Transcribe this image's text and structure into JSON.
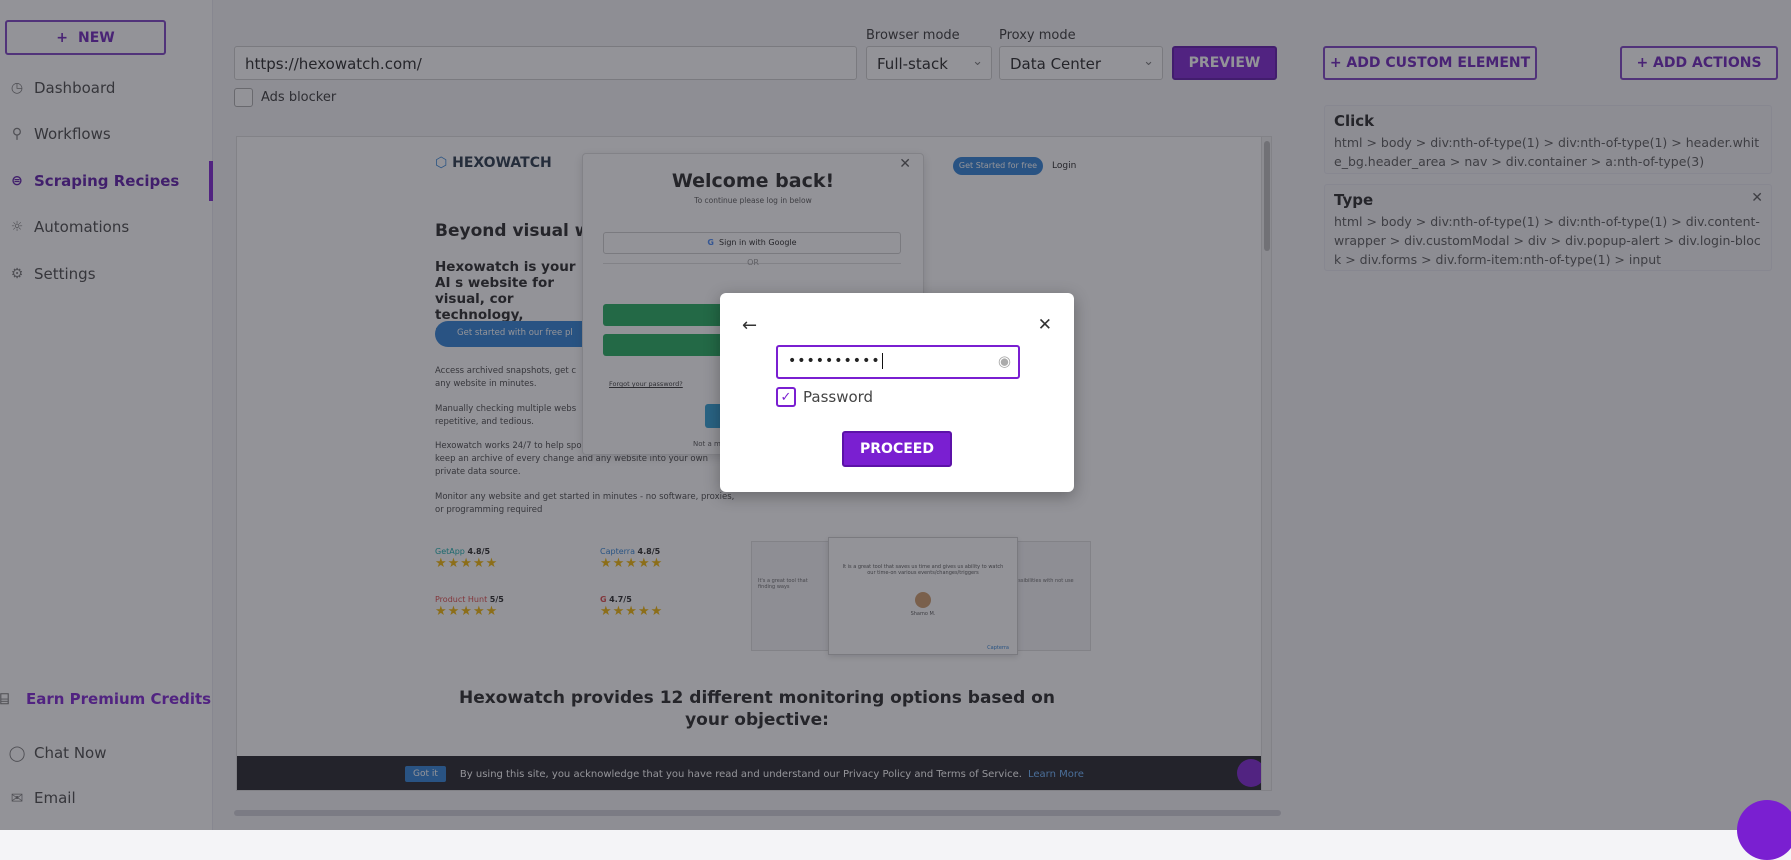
{
  "sidebar": {
    "new_label": "NEW",
    "items": [
      {
        "label": "Dashboard",
        "icon": "clock-icon"
      },
      {
        "label": "Workflows",
        "icon": "workflow-icon"
      },
      {
        "label": "Scraping Recipes",
        "icon": "recipe-icon"
      },
      {
        "label": "Automations",
        "icon": "bulb-icon"
      },
      {
        "label": "Settings",
        "icon": "gear-icon"
      }
    ],
    "earn_label": "Earn Premium Credits",
    "chat_label": "Chat Now",
    "email_label": "Email"
  },
  "toolbar": {
    "url_value": "https://hexowatch.com/",
    "browser_mode_label": "Browser mode",
    "browser_mode_value": "Full-stack",
    "proxy_mode_label": "Proxy mode",
    "proxy_mode_value": "Data Center",
    "preview_label": "PREVIEW",
    "ads_blocker_label": "Ads blocker",
    "add_custom_label": "+ ADD CUSTOM ELEMENT",
    "add_actions_label": "+ ADD ACTIONS"
  },
  "steps": [
    {
      "type": "Click",
      "selector": "html > body > div:nth-of-type(1) > div:nth-of-type(1) > header.white_bg.header_area > nav > div.container > a:nth-of-type(3)"
    },
    {
      "type": "Type",
      "selector": "html > body > div:nth-of-type(1) > div:nth-of-type(1) > div.content-wrapper > div.customModal > div > div.popup-alert > div.login-block > div.forms > div.form-item:nth-of-type(1) > input"
    }
  ],
  "preview_page": {
    "logo": "HEXOWATCH",
    "get_started": "Get Started for free",
    "login": "Login",
    "headline": "Beyond visual we",
    "subhead": "Hexowatch is your AI s website for visual, cor technology, availabili",
    "cta": "Get started with our free pl",
    "para1": "Access archived snapshots, get c any website in minutes.",
    "para2": "Manually checking multiple webs repetitive, and tedious.",
    "para3": "Hexowatch works 24/7 to help spo visually check your website, keep an archive of every change and any website into your own private data source.",
    "para4": "Monitor any website and get started in minutes - no software, proxies, or programming required",
    "rating1_name": "GetApp",
    "rating1": "4.8/5",
    "rating2_name": "Capterra",
    "rating2": "4.8/5",
    "rating3_name": "Product Hunt",
    "rating3": "5/5",
    "rating4": "4.7/5",
    "testimonial_text": "It is a great tool that saves us time and gives us ability to watch our time-on various events/changes/triggers",
    "testimonial_left": "It's a great tool that finding ways",
    "testimonial_right": "possibilities with not use",
    "testimonial_name": "Shamo M.",
    "capterra": "Capterra",
    "bottom_heading": "Hexowatch provides 12 different monitoring options based on your objective:",
    "login_title": "Welcome back!",
    "login_sub": "To continue please log in below",
    "google_label": "Sign in with Google",
    "or": "OR",
    "forgot": "Forgot your password?",
    "not_member": "Not a m",
    "cookie_btn": "Got it",
    "cookie_text": "By using this site, you acknowledge that you have read and understand our Privacy Policy and Terms of Service.",
    "cookie_link": "Learn More"
  },
  "modal": {
    "password_value": "••••••••••",
    "checkbox_label": "Password",
    "proceed_label": "PROCEED"
  },
  "colors": {
    "accent": "#7a1fd1"
  }
}
